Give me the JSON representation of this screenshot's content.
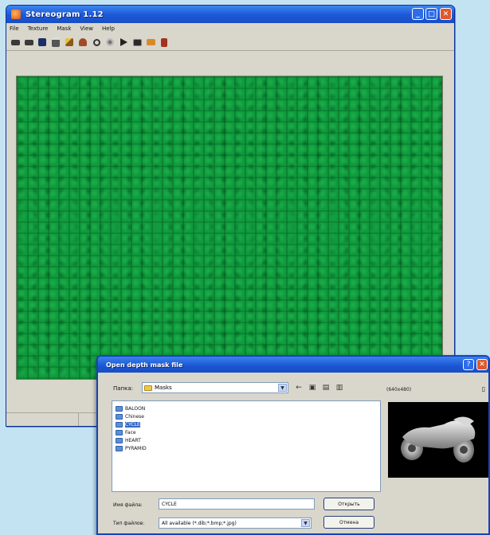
{
  "window": {
    "title": "Stereogram 1.12",
    "controls": {
      "minimize": "_",
      "maximize": "□",
      "close": "✕"
    },
    "menu": [
      "File",
      "Texture",
      "Mask",
      "View",
      "Help"
    ],
    "toolbar_icons": [
      "new-icon",
      "open-icon",
      "save-icon",
      "print-icon",
      "wand-icon",
      "paint-icon",
      "zoom-icon",
      "settings-icon",
      "play-icon",
      "monitor-icon",
      "export-icon",
      "exit-icon"
    ],
    "canvas_color": "#0f9a3c"
  },
  "dialog": {
    "title": "Open depth mask file",
    "help": "?",
    "close": "✕",
    "lookin_label": "Папка:",
    "lookin_value": "Masks",
    "nav_icons": [
      "←",
      "▣",
      "▤",
      "▥"
    ],
    "files": [
      {
        "name": "BALOON"
      },
      {
        "name": "Chinese"
      },
      {
        "name": "CYCLE"
      },
      {
        "name": "Face"
      },
      {
        "name": "HEART"
      },
      {
        "name": "PYRAMID"
      }
    ],
    "selected_file": 2,
    "preview_label": "(640x480)",
    "preview_button": "▯",
    "filename_label": "Имя файла:",
    "filename_value": "CYCLE",
    "filetype_label": "Тип файлов:",
    "filetype_value": "All available (*.dib;*.bmp;*.jpg)",
    "open_button": "Открыть",
    "cancel_button": "Отмена"
  }
}
